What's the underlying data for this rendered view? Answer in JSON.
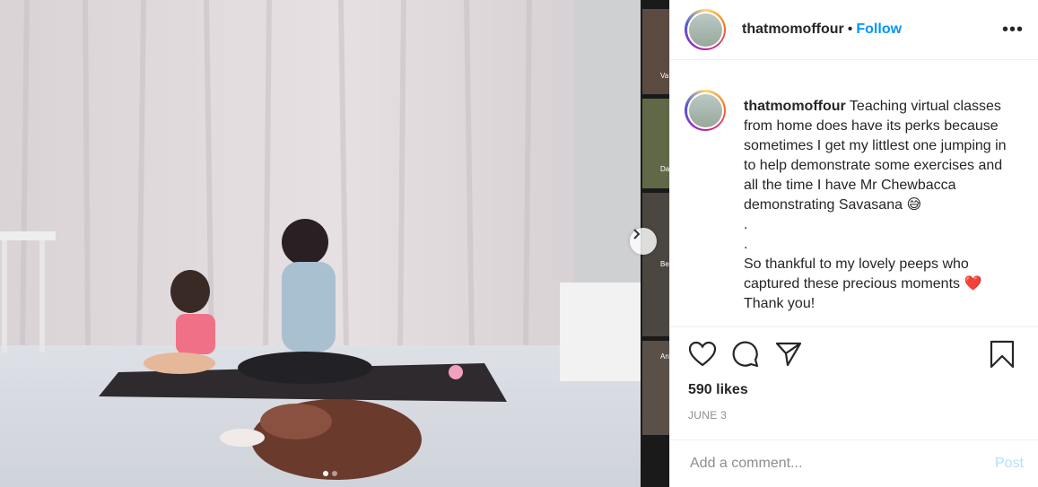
{
  "post": {
    "username": "thatmomoffour",
    "separator": "•",
    "follow_label": "Follow",
    "more_icon": "more-options-icon",
    "caption_username": "thatmomoffour",
    "caption_text": " Teaching virtual classes from home does have its perks because sometimes I get my littlest one jumping in to help demonstrate some exercises and all the time I have Mr Chewbacca demonstrating Savasana 😅\n.\n.\nSo thankful to my lovely peeps who captured these precious moments ❤️\nThank you!",
    "likes": "590 likes",
    "date": "JUNE 3",
    "comment_placeholder": "Add a comment...",
    "post_label": "Post"
  },
  "media": {
    "carousel_total": 2,
    "carousel_active": 1,
    "zoom_tiles": [
      "Va",
      "Da",
      "Be",
      "An"
    ]
  },
  "icons": {
    "like": "heart-icon",
    "comment": "comment-icon",
    "share": "share-icon",
    "save": "bookmark-icon",
    "next": "chevron-right-icon"
  },
  "colors": {
    "accent": "#0095f6",
    "muted": "#8e8e8e",
    "post_disabled": "#b2dffc",
    "heart": "#ed4956"
  }
}
